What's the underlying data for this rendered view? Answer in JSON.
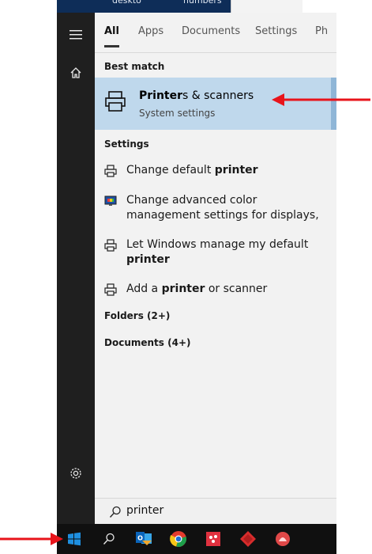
{
  "top_strip": {
    "text_left": "deskto",
    "text_right": "numbers"
  },
  "tabs": [
    {
      "label": "All"
    },
    {
      "label": "Apps"
    },
    {
      "label": "Documents"
    },
    {
      "label": "Settings"
    },
    {
      "label": "Ph"
    }
  ],
  "best_match": {
    "heading": "Best match",
    "title_bold": "Printer",
    "title_rest": "s & scanners",
    "subtitle": "System settings"
  },
  "settings": {
    "heading": "Settings",
    "items": [
      {
        "pre": "Change default ",
        "bold": "printer",
        "post": ""
      },
      {
        "pre": "Change advanced color management settings for displays,",
        "bold": "",
        "post": ""
      },
      {
        "pre": "Let Windows manage my default ",
        "bold": "printer",
        "post": ""
      },
      {
        "pre": "Add a ",
        "bold": "printer",
        "post": " or scanner"
      }
    ]
  },
  "folders": {
    "label": "Folders (2+)"
  },
  "documents": {
    "label": "Documents (4+)"
  },
  "search": {
    "value": "printer"
  },
  "colors": {
    "rail_bg": "#1f1f1f",
    "panel_bg": "#f2f2f2",
    "selected_bg": "#bfd8ec",
    "taskbar_bg": "#101010",
    "arrow": "#e8141b"
  }
}
